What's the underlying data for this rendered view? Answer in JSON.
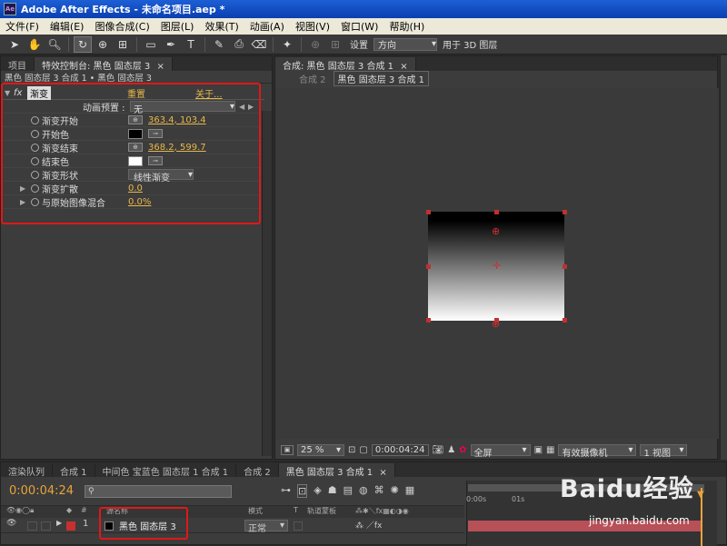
{
  "window": {
    "title": "Adobe After Effects - 未命名项目.aep *",
    "icon_text": "Ae"
  },
  "menu": [
    "文件(F)",
    "编辑(E)",
    "图像合成(C)",
    "图层(L)",
    "效果(T)",
    "动画(A)",
    "视图(V)",
    "窗口(W)",
    "帮助(H)"
  ],
  "toolbar": {
    "set_label": "设置",
    "direction_value": "方向",
    "for_3d_label": "用于 3D 图层"
  },
  "left_panel": {
    "tab_project": "项目",
    "tab_effects": "特效控制台: 黑色 固态层 3",
    "breadcrumb": "黑色 固态层 3 合成 1 • 黑色 固态层 3",
    "effect_name": "渐变",
    "reset_label": "重置",
    "about_label": "关于...",
    "preset_label": "动画预置 :",
    "preset_value": "无",
    "params": [
      {
        "label": "渐变开始",
        "value": "363.4, 103.4"
      },
      {
        "label": "开始色",
        "value": ""
      },
      {
        "label": "渐变结束",
        "value": "368.2, 599.7"
      },
      {
        "label": "结束色",
        "value": ""
      },
      {
        "label": "渐变形状",
        "value": "线性渐变"
      },
      {
        "label": "渐变扩散",
        "value": "0.0"
      },
      {
        "label": "与原始图像混合",
        "value": "0.0%"
      }
    ],
    "start_color": "#000000",
    "end_color": "#ffffff"
  },
  "right_panel": {
    "tab_comp": "合成: 黑色 固态层 3 合成 1",
    "sub_tab_1": "合成 2",
    "sub_tab_2": "黑色 固态层 3 合成 1",
    "zoom": "25 %",
    "timecode": "0:00:04:24",
    "quality": "全屏",
    "camera": "有效摄像机",
    "views": "1 视图"
  },
  "timeline": {
    "tabs": [
      "渲染队列",
      "合成 1",
      "中间色 宝蓝色 固态层 1 合成 1",
      "合成 2",
      "黑色 固态层 3 合成 1"
    ],
    "current_time": "0:00:04:24",
    "col_num": "#",
    "col_name": "源名称",
    "col_mode": "模式",
    "col_t": "T",
    "col_trkmat": "轨道蒙板",
    "ruler_0": "0:00s",
    "ruler_1": "01s",
    "layer": {
      "index": "1",
      "name": "黑色 固态层 3",
      "mode": "正常"
    }
  },
  "watermark": {
    "line1": "Baidu经验",
    "line2": "jingyan.baidu.com"
  },
  "colors": {
    "highlight": "#e01818",
    "value_orange": "#e8b84a"
  }
}
